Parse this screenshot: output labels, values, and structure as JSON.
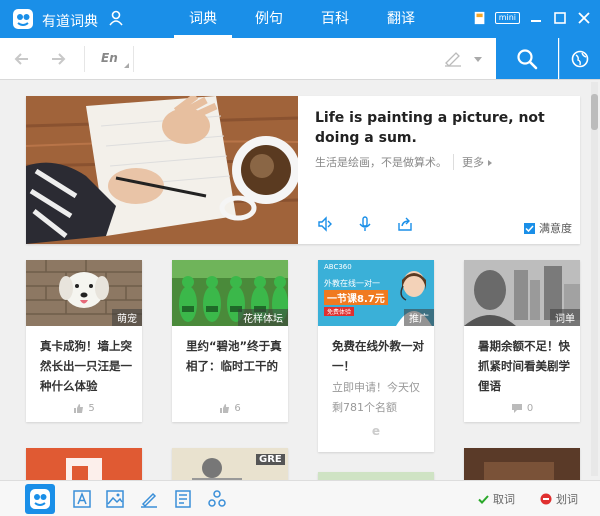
{
  "app": {
    "title": "有道词典"
  },
  "tabs": [
    {
      "label": "词典",
      "active": true
    },
    {
      "label": "例句",
      "active": false
    },
    {
      "label": "百科",
      "active": false
    },
    {
      "label": "翻译",
      "active": false
    }
  ],
  "window": {
    "mini_label": "mini"
  },
  "search": {
    "lang": "En",
    "value": "",
    "placeholder": ""
  },
  "daily": {
    "en": "Life is painting a picture, not doing a sum.",
    "cn": "生活是绘画，不是做算术。",
    "more": "更多",
    "satisfaction": "满意度"
  },
  "cards": [
    {
      "tag": "萌宠",
      "title": "真卡成狗！墙上突然长出一只汪是一种什么体验",
      "stat": "5",
      "stat_icon": "thumbs-up-icon"
    },
    {
      "tag": "花样体坛",
      "title": "里约“碧池”终于真相了：临时工干的",
      "stat": "6",
      "stat_icon": "thumbs-up-icon"
    },
    {
      "tag": "推广",
      "title": "免费在线外教一对一！",
      "subtitle": "立即申请！今天仅剩781个名额",
      "stat": "e",
      "stat_icon": "ad-icon"
    },
    {
      "tag": "词单",
      "title": "暑期余额不足！快抓紧时间看美剧学俚语",
      "stat": "0",
      "stat_icon": "comment-icon"
    }
  ],
  "ad_banner": {
    "brand": "ABC360",
    "line1": "外教在线一对一",
    "line2": "一节课8.7元",
    "badge": "免费体验"
  },
  "row2_tags": {
    "gre": "GRE"
  },
  "bottom": {
    "fetch_word": "取词",
    "pick_word": "划词"
  },
  "colors": {
    "brand": "#1a8fe8",
    "check_green": "#2aa82a",
    "pick_red": "#e03030"
  }
}
